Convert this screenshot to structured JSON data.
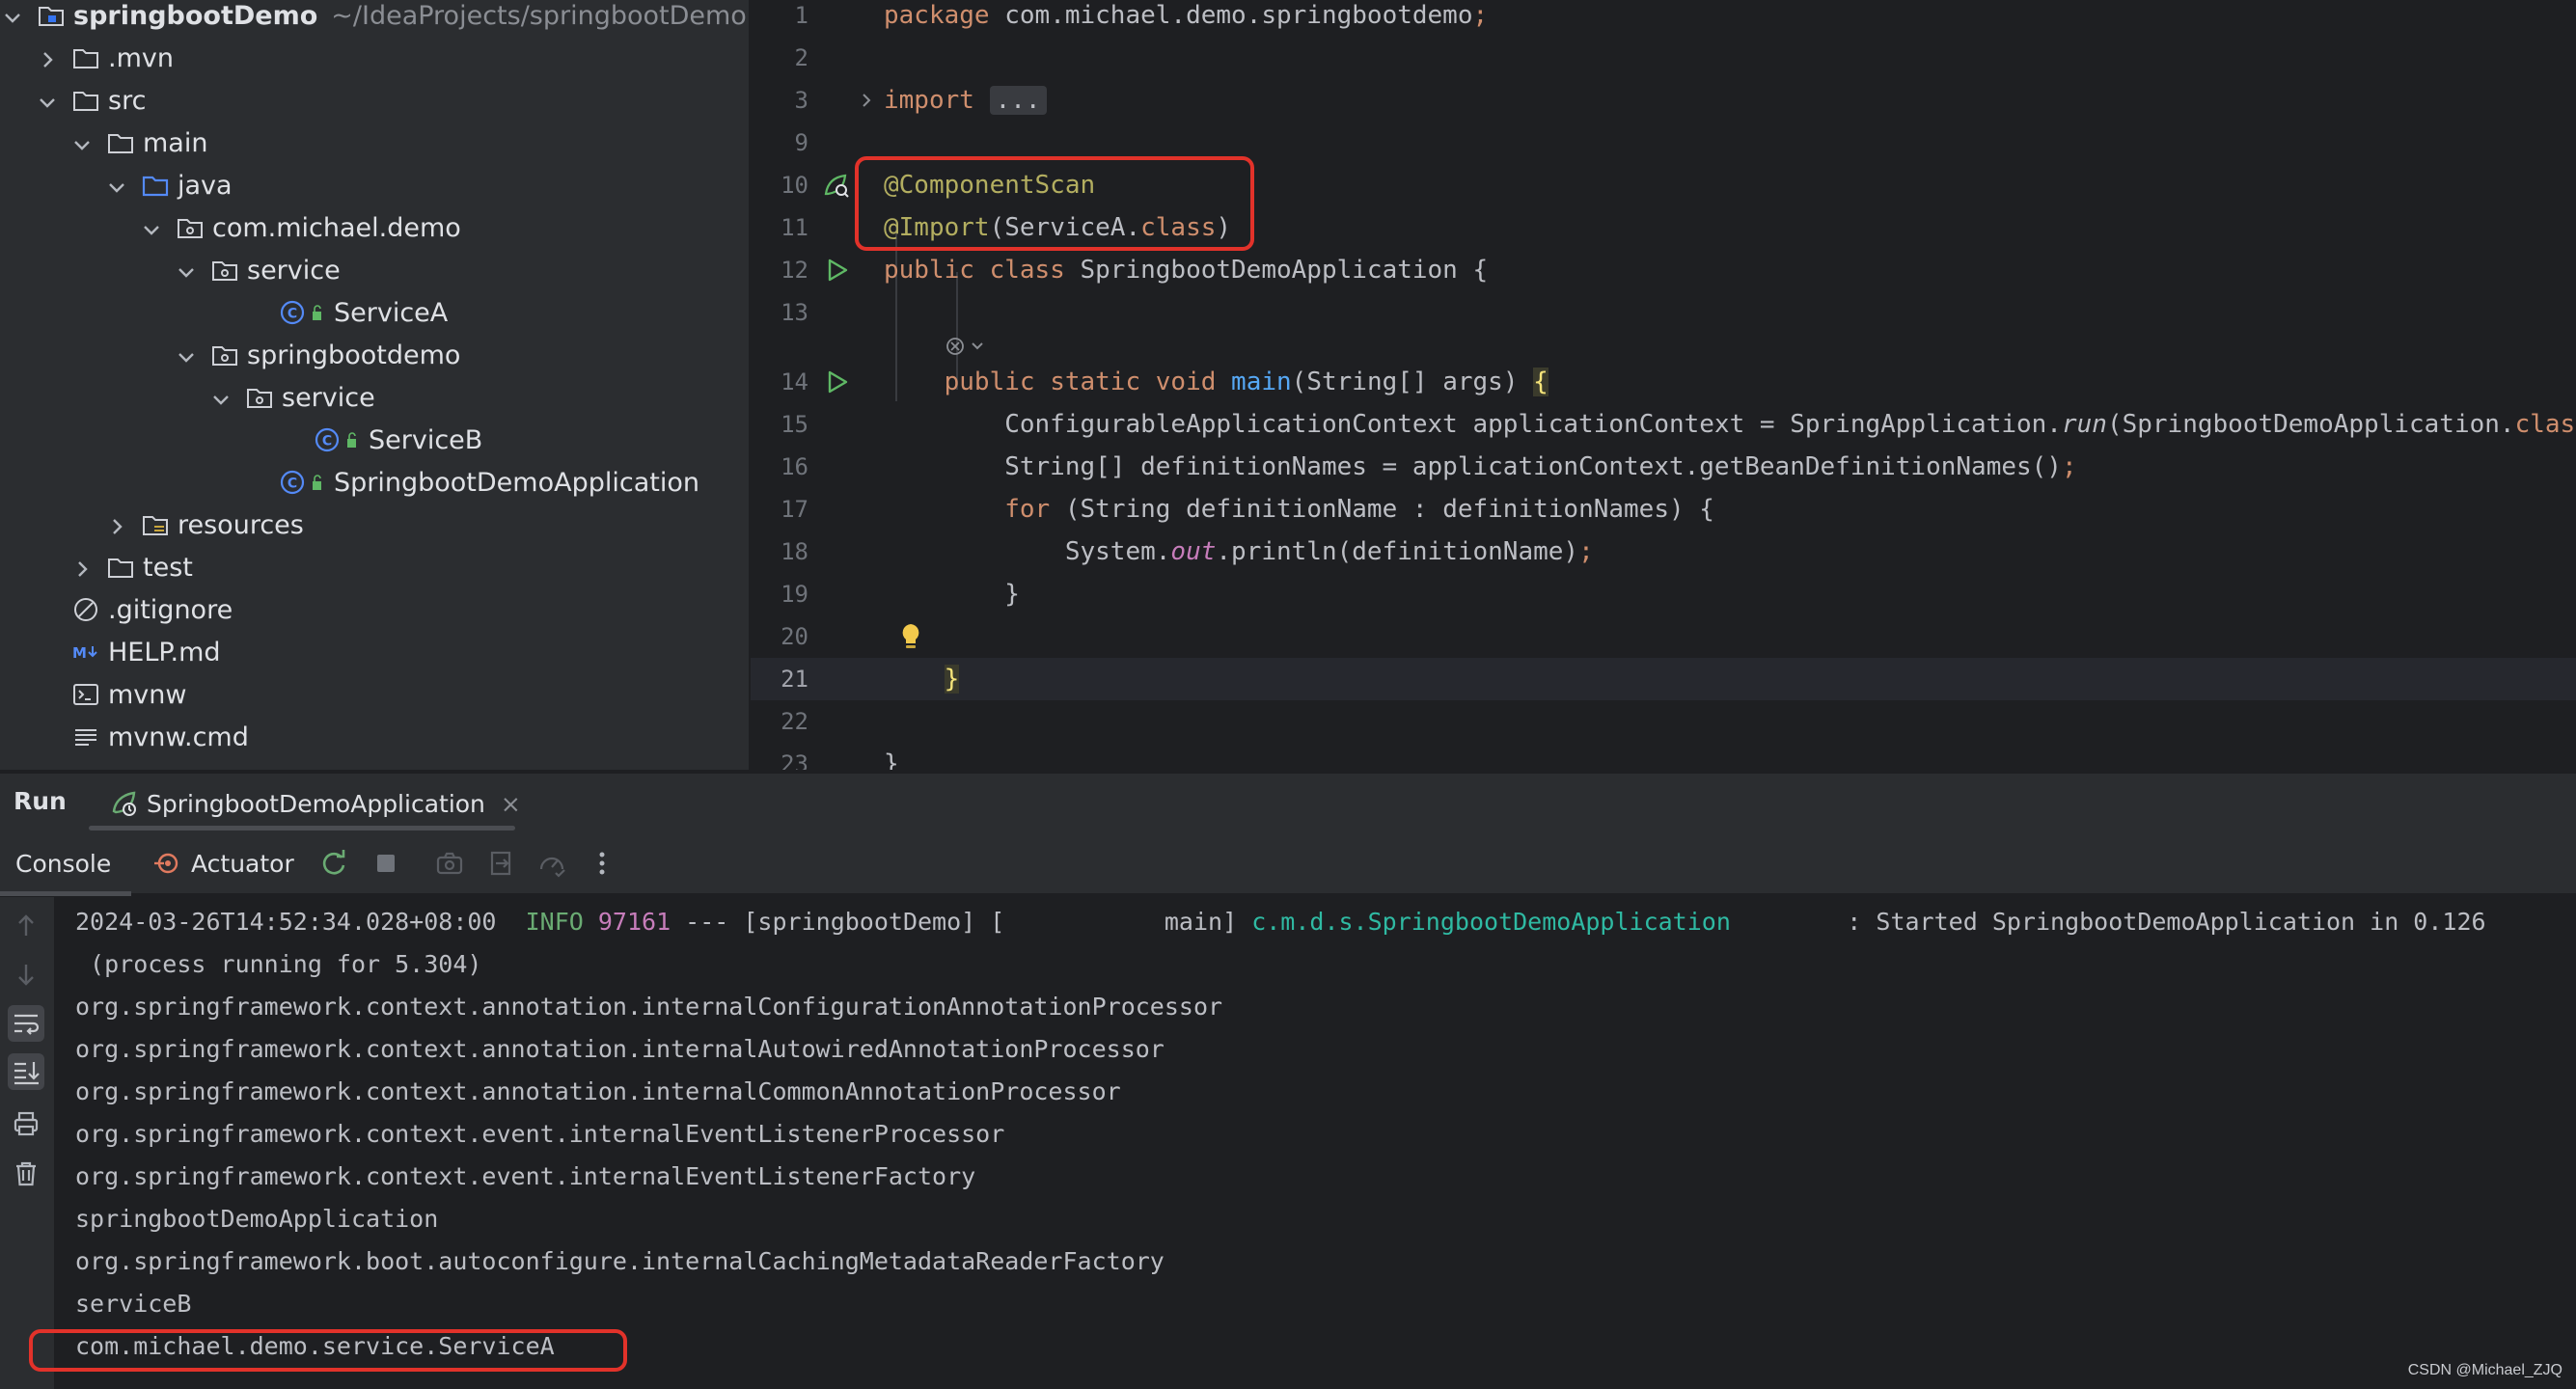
{
  "project_tree": {
    "items": [
      {
        "label": "springbootDemo",
        "path": "~/IdeaProjects/springbootDemo",
        "depth": 0,
        "chevron": "down",
        "icon": "module-folder-icon",
        "bold": true
      },
      {
        "label": ".mvn",
        "depth": 1,
        "chevron": "right",
        "icon": "folder-icon"
      },
      {
        "label": "src",
        "depth": 1,
        "chevron": "down",
        "icon": "folder-icon"
      },
      {
        "label": "main",
        "depth": 2,
        "chevron": "down",
        "icon": "folder-icon"
      },
      {
        "label": "java",
        "depth": 3,
        "chevron": "down",
        "icon": "source-folder-icon"
      },
      {
        "label": "com.michael.demo",
        "depth": 4,
        "chevron": "down",
        "icon": "package-icon"
      },
      {
        "label": "service",
        "depth": 5,
        "chevron": "down",
        "icon": "package-icon"
      },
      {
        "label": "ServiceA",
        "depth": 7,
        "chevron": "none",
        "icon": "class-icon"
      },
      {
        "label": "springbootdemo",
        "depth": 5,
        "chevron": "down",
        "icon": "package-icon"
      },
      {
        "label": "service",
        "depth": 6,
        "chevron": "down",
        "icon": "package-icon"
      },
      {
        "label": "ServiceB",
        "depth": 8,
        "chevron": "none",
        "icon": "class-icon"
      },
      {
        "label": "SpringbootDemoApplication",
        "depth": 7,
        "chevron": "none",
        "icon": "class-icon"
      },
      {
        "label": "resources",
        "depth": 3,
        "chevron": "right",
        "icon": "resources-folder-icon"
      },
      {
        "label": "test",
        "depth": 2,
        "chevron": "right",
        "icon": "folder-icon"
      },
      {
        "label": ".gitignore",
        "depth": 1,
        "chevron": "none",
        "icon": "ignore-file-icon"
      },
      {
        "label": "HELP.md",
        "depth": 1,
        "chevron": "none",
        "icon": "markdown-icon"
      },
      {
        "label": "mvnw",
        "depth": 1,
        "chevron": "none",
        "icon": "script-icon"
      },
      {
        "label": "mvnw.cmd",
        "depth": 1,
        "chevron": "none",
        "icon": "text-file-icon"
      }
    ]
  },
  "editor": {
    "lines": [
      {
        "n": "1",
        "segments": [
          [
            "kw",
            "package "
          ],
          [
            "",
            "com.michael.demo.springbootdemo"
          ],
          [
            "kw",
            ";"
          ]
        ]
      },
      {
        "n": "2",
        "segments": []
      },
      {
        "n": "3",
        "segments": [
          [
            "kw",
            "import "
          ],
          [
            "fold",
            "..."
          ]
        ],
        "fold_marker": true
      },
      {
        "n": "9",
        "segments": []
      },
      {
        "n": "10",
        "segments": [
          [
            "ann",
            "@ComponentScan"
          ]
        ],
        "gutter": "bean-scan-icon"
      },
      {
        "n": "11",
        "segments": [
          [
            "ann",
            "@Import"
          ],
          [
            "",
            "(ServiceA."
          ],
          [
            "kw",
            "class"
          ],
          [
            "",
            ")"
          ]
        ]
      },
      {
        "n": "12",
        "segments": [
          [
            "kw",
            "public class "
          ],
          [
            "",
            "SpringbootDemoApplication {"
          ]
        ],
        "gutter": "run-icon"
      },
      {
        "n": "13",
        "segments": []
      },
      {
        "n": "",
        "segments": [
          [
            "",
            "    "
          ]
        ],
        "inlay": "ai-actions-icon"
      },
      {
        "n": "14",
        "segments": [
          [
            "",
            "    "
          ],
          [
            "kw",
            "public static void "
          ],
          [
            "fn",
            "main"
          ],
          [
            "",
            "(String[] args) "
          ],
          [
            "brace",
            "{"
          ]
        ],
        "gutter": "run-icon"
      },
      {
        "n": "15",
        "segments": [
          [
            "",
            "        ConfigurableApplicationContext applicationContext = SpringApplication."
          ],
          [
            "italic",
            "run"
          ],
          [
            "",
            "(SpringbootDemoApplication."
          ],
          [
            "kw",
            "class"
          ]
        ]
      },
      {
        "n": "16",
        "segments": [
          [
            "",
            "        String[] definitionNames = applicationContext.getBeanDefinitionNames()"
          ],
          [
            "kw",
            ";"
          ]
        ]
      },
      {
        "n": "17",
        "segments": [
          [
            "",
            "        "
          ],
          [
            "kw",
            "for "
          ],
          [
            "",
            "(String definitionName : definitionNames) {"
          ]
        ]
      },
      {
        "n": "18",
        "segments": [
          [
            "",
            "            System."
          ],
          [
            "fld",
            "out"
          ],
          [
            "",
            ".println(definitionName)"
          ],
          [
            "kw",
            ";"
          ]
        ]
      },
      {
        "n": "19",
        "segments": [
          [
            "",
            "        }"
          ]
        ]
      },
      {
        "n": "20",
        "segments": [],
        "bulb": "lightbulb-icon"
      },
      {
        "n": "21",
        "segments": [
          [
            "",
            "    "
          ],
          [
            "brace",
            "}"
          ]
        ],
        "current": true
      },
      {
        "n": "22",
        "segments": []
      },
      {
        "n": "23",
        "segments": [
          [
            "",
            "}"
          ]
        ]
      }
    ]
  },
  "run_window": {
    "title": "Run",
    "tab_label": "SpringbootDemoApplication",
    "close_glyph": "×",
    "toolbar": {
      "console_label": "Console",
      "actuator_label": "Actuator"
    },
    "console_lines": [
      [
        [
          "",
          "2024-03-26T14:52:34.028+08:00  "
        ],
        [
          "info",
          "INFO "
        ],
        [
          "pid",
          "97161"
        ],
        [
          "",
          " --- [springbootDemo] [           main] "
        ],
        [
          "logger",
          "c.m.d.s.SpringbootDemoApplication"
        ],
        [
          "",
          "        : Started SpringbootDemoApplication in 0.126"
        ]
      ],
      [
        [
          "",
          " (process running for 5.304)"
        ]
      ],
      [
        [
          "",
          "org.springframework.context.annotation.internalConfigurationAnnotationProcessor"
        ]
      ],
      [
        [
          "",
          "org.springframework.context.annotation.internalAutowiredAnnotationProcessor"
        ]
      ],
      [
        [
          "",
          "org.springframework.context.annotation.internalCommonAnnotationProcessor"
        ]
      ],
      [
        [
          "",
          "org.springframework.context.event.internalEventListenerProcessor"
        ]
      ],
      [
        [
          "",
          "org.springframework.context.event.internalEventListenerFactory"
        ]
      ],
      [
        [
          "",
          "springbootDemoApplication"
        ]
      ],
      [
        [
          "",
          "org.springframework.boot.autoconfigure.internalCachingMetadataReaderFactory"
        ]
      ],
      [
        [
          "",
          "serviceB"
        ]
      ],
      [
        [
          "",
          "com.michael.demo.service.ServiceA"
        ]
      ]
    ]
  },
  "watermark": "CSDN @Michael_ZJQ",
  "colors": {
    "highlight_box": "#e2322a",
    "keyword": "#cf8e6d",
    "annotation": "#b3ae60",
    "info": "#6aab73",
    "logger": "#2fbaa3"
  }
}
